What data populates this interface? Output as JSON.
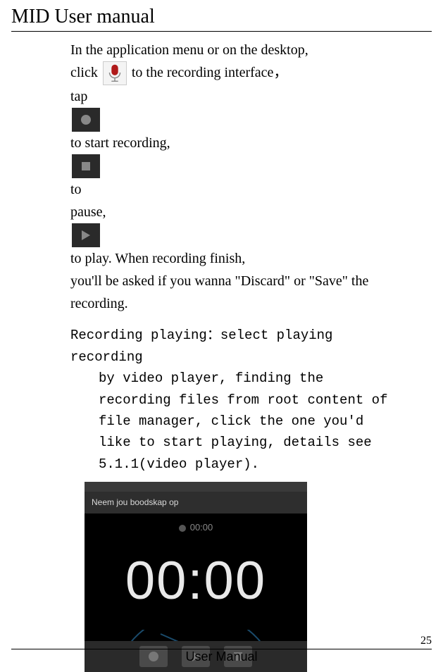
{
  "title": "MID User manual",
  "body": {
    "line1": "In the application menu or on the desktop,",
    "line2a": "click ",
    "line2b": "to the recording interface，",
    "line3a": "tap",
    "line3b": "to start recording, ",
    "line3c": "to",
    "line4a": "pause,",
    "line4b": " to play. When recording finish,",
    "line5": "you'll be asked if you wanna \"Discard\" or \"Save\" the recording."
  },
  "section2": {
    "lead": "Recording playing：select playing recording",
    "cont": "by video player, finding the recording files from root content of file manager, click the one you'd like to start playing, details see 5.1.1(video player)."
  },
  "screenshot": {
    "header": "Neem jou boodskap op",
    "rec_indicator_time": "00:00",
    "timer": "00:00"
  },
  "footer": {
    "page": "25",
    "label": "User Manual"
  }
}
